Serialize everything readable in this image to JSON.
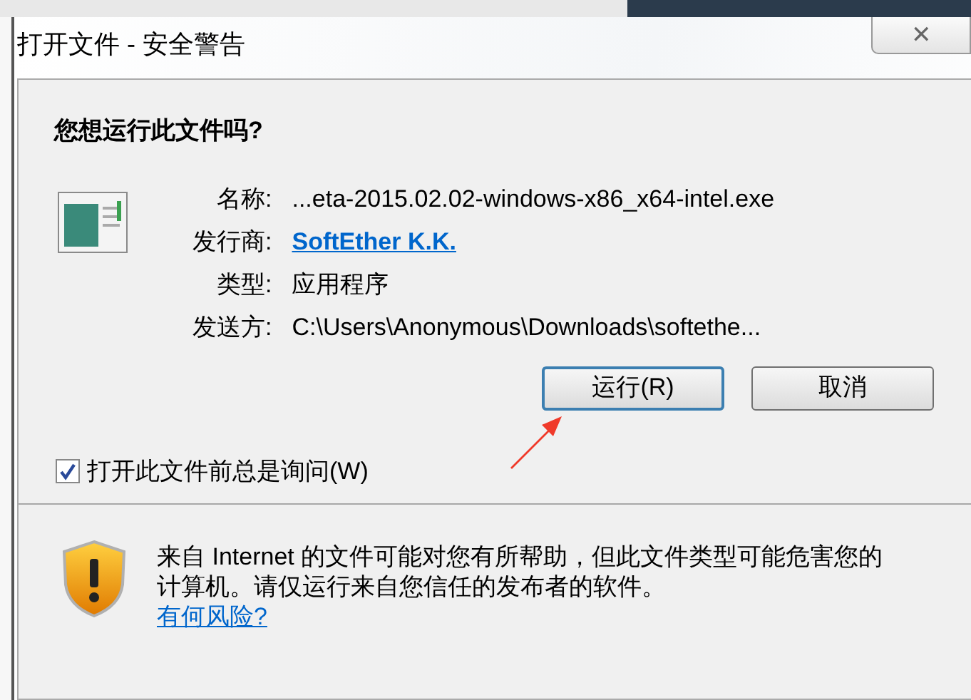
{
  "window": {
    "title": "打开文件 - 安全警告",
    "close": "✕"
  },
  "question": "您想运行此文件吗?",
  "details": [
    {
      "label": "名称:",
      "value": "...eta-2015.02.02-windows-x86_x64-intel.exe",
      "kind": "text"
    },
    {
      "label": "发行商:",
      "value": "SoftEther K.K.",
      "kind": "link"
    },
    {
      "label": "类型:",
      "value": "应用程序",
      "kind": "text"
    },
    {
      "label": "发送方:",
      "value": "C:\\Users\\Anonymous\\Downloads\\softethe...",
      "kind": "text"
    }
  ],
  "buttons": [
    {
      "label": "运行(R)",
      "selected": true
    },
    {
      "label": "取消",
      "selected": false
    }
  ],
  "always_ask": {
    "label": "打开此文件前总是询问(W)",
    "checked": true
  },
  "warning": {
    "text": "来自 Internet 的文件可能对您有所帮助，但此文件类型可能危害您的计算机。请仅运行来自您信任的发布者的软件。",
    "link": "有何风险?"
  }
}
